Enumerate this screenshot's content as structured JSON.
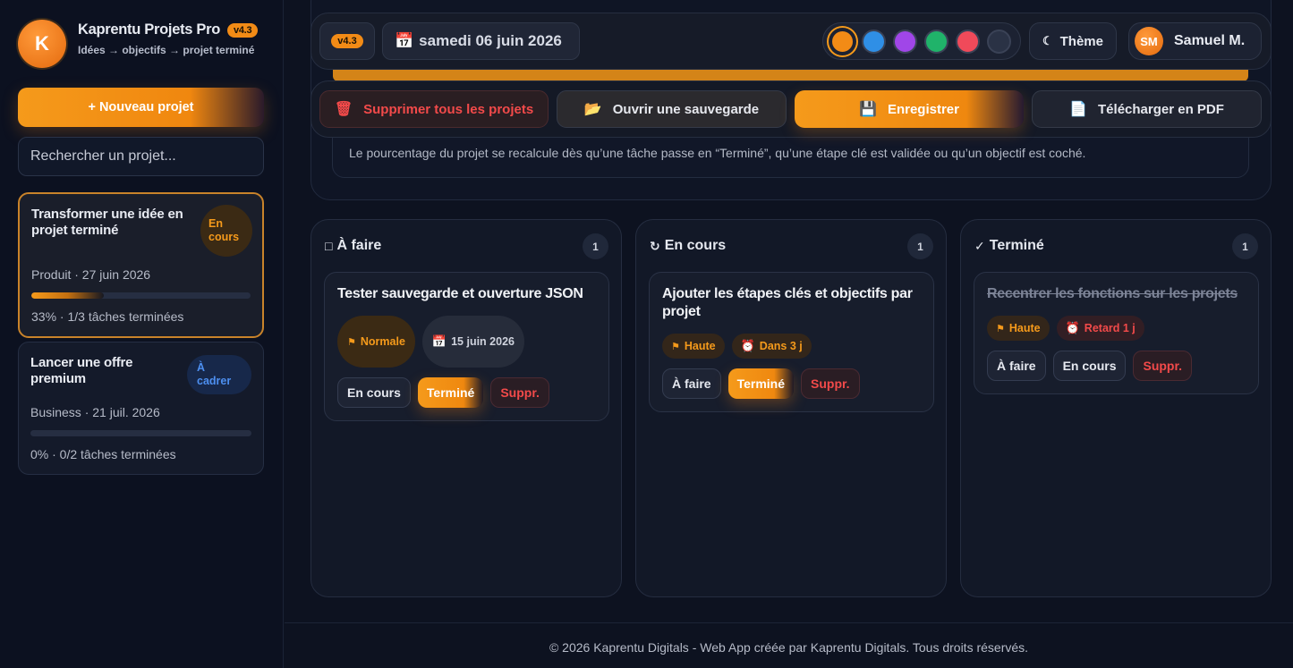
{
  "brand": {
    "logo_letter": "K",
    "title": "Kaprentu Projets Pro",
    "version": "v4.3",
    "subtitle": "Idées → objectifs → projet terminé"
  },
  "sidebar": {
    "new_project_label": "+ Nouveau projet",
    "search_placeholder": "Rechercher un projet...",
    "projects": [
      {
        "title": "Transformer une idée en projet terminé",
        "status": "En cours",
        "meta": "Produit · 27 juin 2026",
        "progress": 33,
        "stat": "33% · 1/3 tâches terminées",
        "active": true
      },
      {
        "title": "Lancer une offre premium",
        "status": "À cadrer",
        "meta": "Business · 21 juil. 2026",
        "progress": 0,
        "stat": "0% · 0/2 tâches terminées",
        "active": false
      }
    ]
  },
  "header": {
    "version": "v4.3",
    "date_icon": "📅",
    "date": "samedi 06 juin 2026",
    "swatches": [
      "#f28b16",
      "#2f8fe6",
      "#a046e8",
      "#20b36a",
      "#f04a5a",
      "#2a3245"
    ],
    "selected_swatch": 0,
    "theme_label": "Thème",
    "user_initials": "SM",
    "user_name": "Samuel M."
  },
  "toolbar": {
    "delete_label": "Supprimer tous les projets",
    "open_label": "Ouvrir une sauvegarde",
    "save_label": "Enregistrer",
    "pdf_label": "Télécharger en PDF"
  },
  "hint": "Le pourcentage du projet se recalcule dès qu’une tâche passe en “Terminé”, qu’une étape clé est validée ou qu’un objectif est coché.",
  "kanban": {
    "columns": [
      {
        "icon": "□",
        "title": "À faire",
        "count": "1",
        "task": {
          "title": "Tester sauvegarde et ouverture JSON",
          "priority": "Normale",
          "date": "15 juin 2026",
          "actions": [
            "En cours",
            "Terminé",
            "Suppr."
          ]
        }
      },
      {
        "icon": "↻",
        "title": "En cours",
        "count": "1",
        "task": {
          "title": "Ajouter les étapes clés et objectifs par projet",
          "priority": "Haute",
          "due": "Dans 3 j",
          "actions": [
            "À faire",
            "Terminé",
            "Suppr."
          ]
        }
      },
      {
        "icon": "✓",
        "title": "Terminé",
        "count": "1",
        "task": {
          "title": "Recentrer les fonctions sur les projets",
          "priority": "Haute",
          "due": "Retard 1 j",
          "actions": [
            "À faire",
            "En cours",
            "Suppr."
          ]
        }
      }
    ]
  },
  "footer": "© 2026 Kaprentu Digitals - Web App créée par Kaprentu Digitals. Tous droits réservés."
}
